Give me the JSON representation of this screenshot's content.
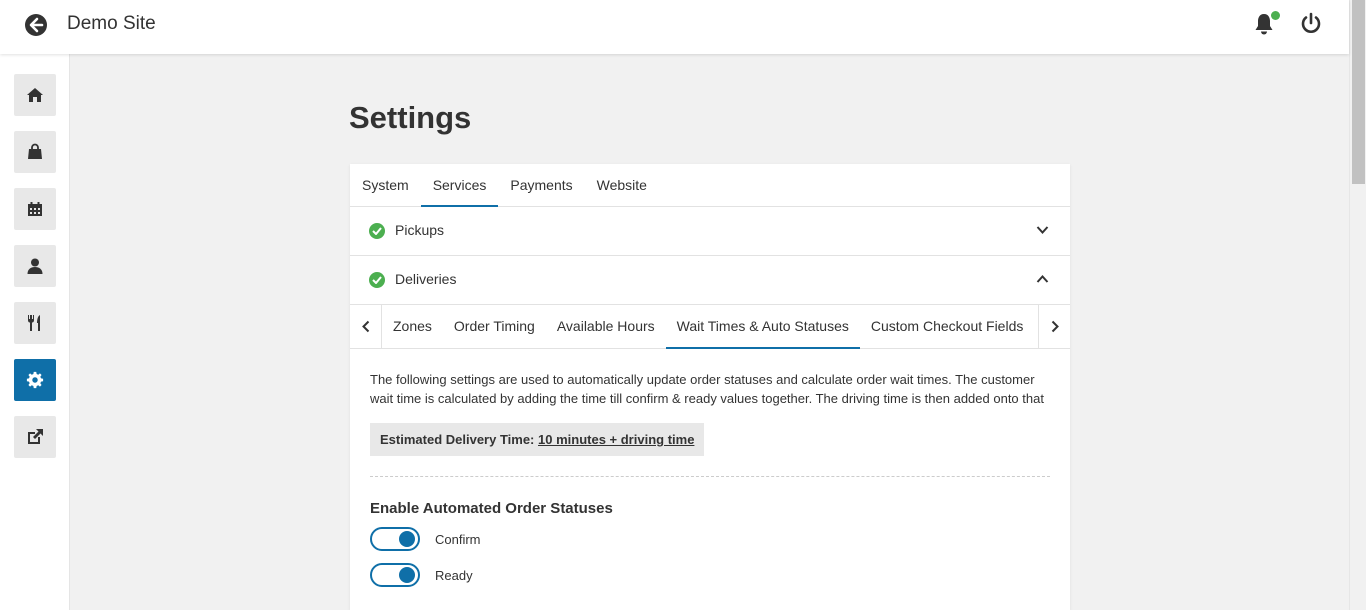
{
  "header": {
    "title": "Demo Site"
  },
  "page": {
    "title": "Settings"
  },
  "tabs": [
    {
      "label": "System",
      "active": false
    },
    {
      "label": "Services",
      "active": true
    },
    {
      "label": "Payments",
      "active": false
    },
    {
      "label": "Website",
      "active": false
    }
  ],
  "sections": {
    "pickups": {
      "label": "Pickups",
      "expanded": false
    },
    "deliveries": {
      "label": "Deliveries",
      "expanded": true
    }
  },
  "subtabs": [
    {
      "label": "Zones",
      "active": false
    },
    {
      "label": "Order Timing",
      "active": false
    },
    {
      "label": "Available Hours",
      "active": false
    },
    {
      "label": "Wait Times & Auto Statuses",
      "active": true
    },
    {
      "label": "Custom Checkout Fields",
      "active": false
    }
  ],
  "content": {
    "description": "The following settings are used to automatically update order statuses and calculate order wait times. The customer wait time is calculated by adding the time till confirm & ready values together. The driving time is then added onto that",
    "estimate_label": "Estimated Delivery Time:",
    "estimate_value": "10 minutes + driving time",
    "enable_title": "Enable Automated Order Statuses",
    "toggles": [
      {
        "label": "Confirm",
        "on": true
      },
      {
        "label": "Ready",
        "on": true
      }
    ]
  },
  "sidebar": {
    "items": [
      {
        "icon": "home-icon",
        "active": false
      },
      {
        "icon": "shopping-bag-icon",
        "active": false
      },
      {
        "icon": "calendar-icon",
        "active": false
      },
      {
        "icon": "user-icon",
        "active": false
      },
      {
        "icon": "utensils-icon",
        "active": false
      },
      {
        "icon": "gear-icon",
        "active": true
      },
      {
        "icon": "external-link-icon",
        "active": false
      }
    ]
  },
  "colors": {
    "accent": "#0f6fa8",
    "success": "#4caf50",
    "background": "#f1f1f1"
  }
}
